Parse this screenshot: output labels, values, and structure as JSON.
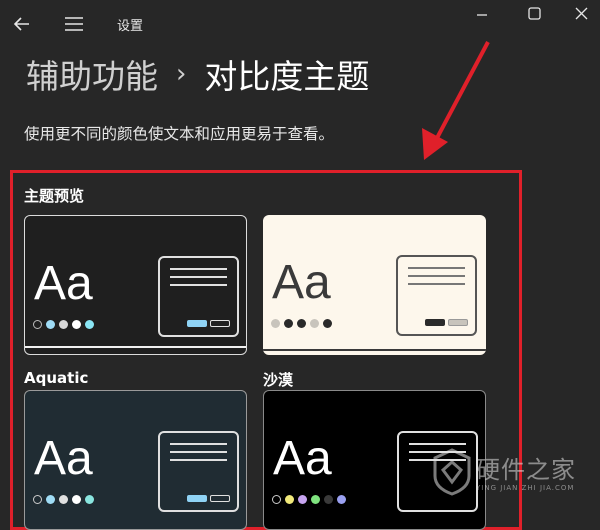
{
  "titlebar": {
    "app_title": "设置"
  },
  "header": {
    "breadcrumb_parent": "辅助功能",
    "breadcrumb_separator": "›",
    "page_title": "对比度主题",
    "description": "使用更不同的颜色使文本和应用更易于查看。"
  },
  "preview": {
    "section_title": "主题预览",
    "themes": [
      {
        "name": "",
        "aa": "Aa"
      },
      {
        "name": "",
        "aa": "Aa"
      },
      {
        "name": "Aquatic",
        "aa": "Aa"
      },
      {
        "name": "沙漠",
        "aa": "Aa"
      }
    ]
  },
  "watermark": {
    "main": "硬件之家",
    "sub": "YING JIAN ZHI JIA.COM"
  }
}
